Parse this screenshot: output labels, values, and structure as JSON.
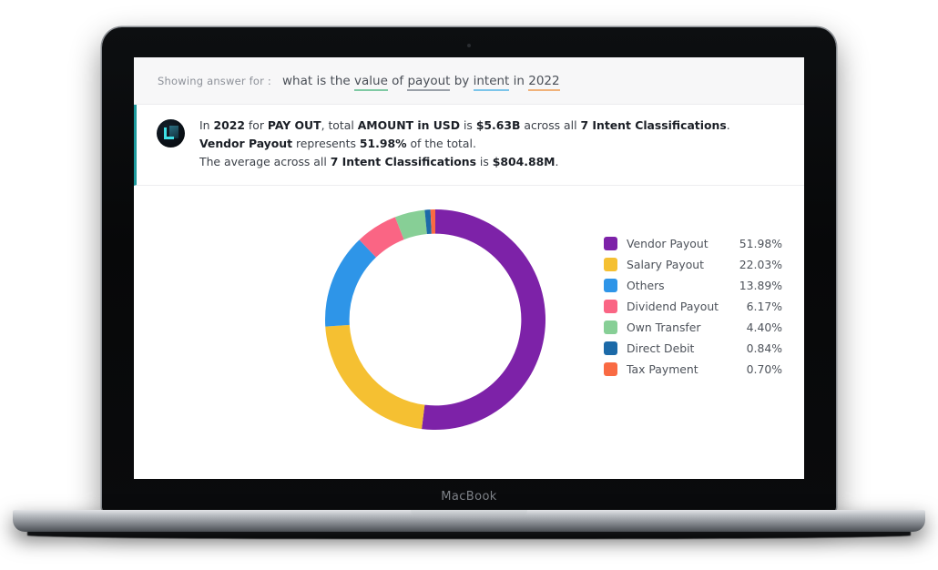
{
  "device": {
    "wordmark": "MacBook"
  },
  "query": {
    "prefix": "Showing answer for :",
    "full_text": "what is the value of payout by intent in 2022",
    "tokens": [
      {
        "text": "what is the ",
        "type": "plain"
      },
      {
        "text": "value",
        "type": "metric",
        "underline": "#7fc9a4"
      },
      {
        "text": " of ",
        "type": "plain"
      },
      {
        "text": "payout",
        "type": "entity",
        "underline": "#9aa0a8"
      },
      {
        "text": " by ",
        "type": "plain"
      },
      {
        "text": "intent",
        "type": "dimension",
        "underline": "#7cc5ea"
      },
      {
        "text": " in ",
        "type": "plain"
      },
      {
        "text": "2022",
        "type": "time",
        "underline": "#f0b27a"
      }
    ]
  },
  "answer": {
    "line1": {
      "p1": "In ",
      "b1": "2022",
      "p2": " for ",
      "b2": "PAY OUT",
      "p3": ", total ",
      "b3": "AMOUNT in USD",
      "p4": " is ",
      "b4": "$5.63B",
      "p5": " across all ",
      "b5": "7 Intent Classifications",
      "p6": "."
    },
    "line2": {
      "b1": "Vendor Payout",
      "p1": " represents ",
      "b2": "51.98%",
      "p2": " of the total."
    },
    "line3": {
      "p1": "The average across all ",
      "b1": "7 Intent Classifications",
      "p2": " is ",
      "b2": "$804.88M",
      "p3": "."
    }
  },
  "chart_data": {
    "type": "pie",
    "variant": "donut",
    "title": "",
    "start_angle_deg": 0,
    "direction": "clockwise",
    "inner_radius_ratio": 0.78,
    "legend_position": "right",
    "categories": [
      "Vendor Payout",
      "Salary Payout",
      "Others",
      "Dividend Payout",
      "Own Transfer",
      "Direct Debit",
      "Tax Payment"
    ],
    "values": [
      51.98,
      22.03,
      13.89,
      6.17,
      4.4,
      0.84,
      0.7
    ],
    "value_labels": [
      "51.98%",
      "22.03%",
      "13.89%",
      "6.17%",
      "4.40%",
      "0.84%",
      "0.70%"
    ],
    "colors": [
      "#7d22a8",
      "#f5c032",
      "#2e95e8",
      "#fa6584",
      "#87cf96",
      "#1c6aa8",
      "#f96a43"
    ],
    "unit": "percent",
    "total_label": "$5.63B",
    "average_label": "$804.88M",
    "slices": [
      {
        "label": "Vendor Payout",
        "value": 51.98,
        "display": "51.98%",
        "color": "#7d22a8"
      },
      {
        "label": "Salary Payout",
        "value": 22.03,
        "display": "22.03%",
        "color": "#f5c032"
      },
      {
        "label": "Others",
        "value": 13.89,
        "display": "13.89%",
        "color": "#2e95e8"
      },
      {
        "label": "Dividend Payout",
        "value": 6.17,
        "display": "6.17%",
        "color": "#fa6584"
      },
      {
        "label": "Own Transfer",
        "value": 4.4,
        "display": "4.40%",
        "color": "#87cf96"
      },
      {
        "label": "Direct Debit",
        "value": 0.84,
        "display": "0.84%",
        "color": "#1c6aa8"
      },
      {
        "label": "Tax Payment",
        "value": 0.7,
        "display": "0.70%",
        "color": "#f96a43"
      }
    ]
  },
  "theme": {
    "accent_teal": "#1d9a9d",
    "query_bar_bg": "#f7f7f8",
    "text_primary": "#1b1f26",
    "text_secondary": "#4d525a",
    "text_muted": "#8d9199"
  }
}
